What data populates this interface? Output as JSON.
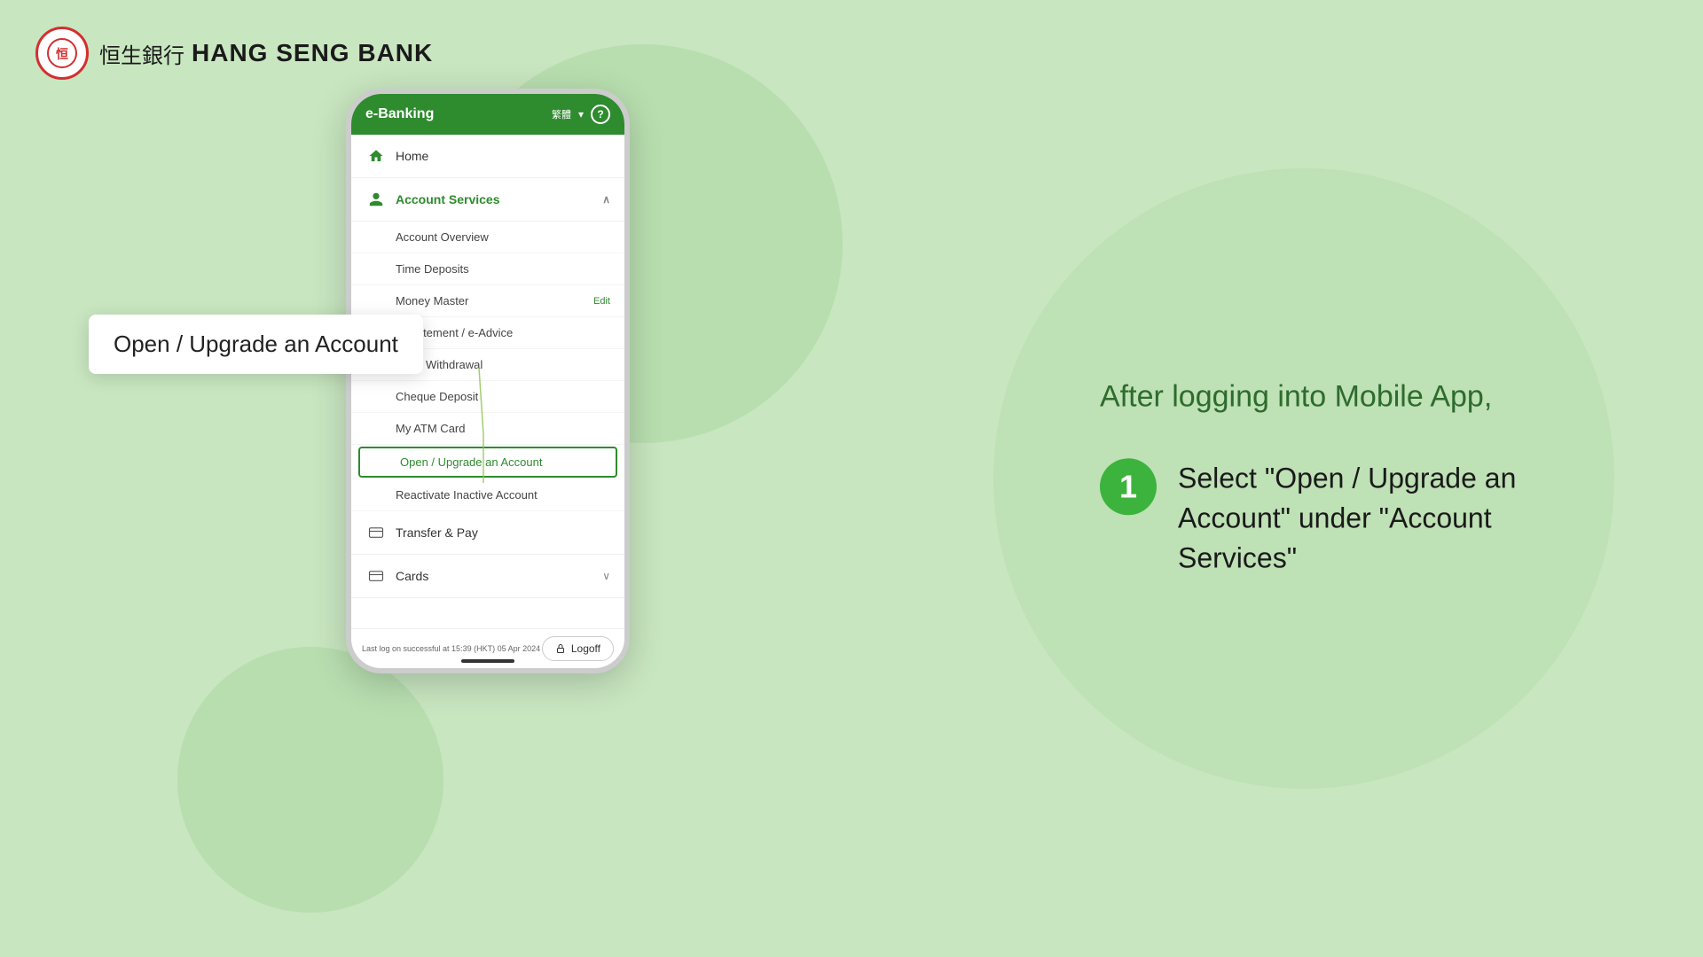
{
  "brand": {
    "logo_alt": "Hang Seng Bank Logo",
    "chinese_name": "恒生銀行",
    "english_name": "HANG SENG BANK"
  },
  "header": {
    "subtitle": "After logging into Mobile App,"
  },
  "phone": {
    "title": "e-Banking",
    "lang": "繁體",
    "lang_toggle": "▾",
    "help_icon": "?",
    "menu": {
      "home": "Home",
      "account_services": "Account Services",
      "sub_items": [
        "Account Overview",
        "Time Deposits",
        "Money Master",
        "e-Statement / e-Advice",
        "Cash Withdrawal",
        "Cheque Deposit",
        "My ATM Card",
        "Open / Upgrade an Account",
        "Reactivate Inactive Account"
      ],
      "transfer_pay": "Transfer & Pay",
      "cards": "Cards"
    },
    "last_login": "Last log on successful at 15:39\n(HKT) 05 Apr 2024",
    "logoff": "Logoff"
  },
  "callout": {
    "text": "Open / Upgrade an Account"
  },
  "step": {
    "number": "1",
    "description_line1": "Select \"Open / Upgrade an",
    "description_line2": "Account\" under \"Account",
    "description_line3": "Services\""
  },
  "sidebar_partial": {
    "money_master_edit": "Edit"
  }
}
